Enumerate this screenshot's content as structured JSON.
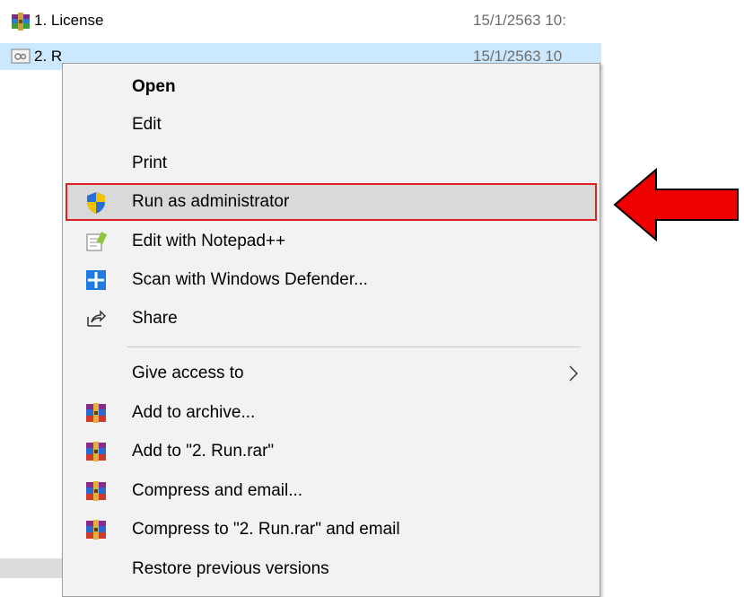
{
  "files": [
    {
      "name": "1. License",
      "date": "15/1/2563 10:",
      "icon": "winrar-archive-icon"
    },
    {
      "name": "2. R",
      "date": "15/1/2563 10",
      "icon": "batch-file-icon"
    }
  ],
  "menu": {
    "items": [
      {
        "label": "Open",
        "bold": true
      },
      {
        "label": "Edit"
      },
      {
        "label": "Print"
      },
      {
        "label": "Run as administrator",
        "icon": "uac-shield-icon",
        "highlighted": true
      },
      {
        "label": "Edit with Notepad++",
        "icon": "notepad-plus-plus-icon"
      },
      {
        "label": "Scan with Windows Defender...",
        "icon": "windows-defender-icon"
      },
      {
        "label": "Share",
        "icon": "share-icon"
      },
      {
        "label": "Give access to",
        "submenu": true
      },
      {
        "label": "Add to archive...",
        "icon": "winrar-icon"
      },
      {
        "label": "Add to \"2. Run.rar\"",
        "icon": "winrar-icon"
      },
      {
        "label": "Compress and email...",
        "icon": "winrar-icon"
      },
      {
        "label": "Compress to \"2. Run.rar\" and email",
        "icon": "winrar-icon"
      },
      {
        "label": "Restore previous versions"
      }
    ]
  },
  "colors": {
    "selection": "#cce8ff",
    "menu_bg": "#f2f2f2",
    "highlight_border": "#e02020",
    "arrow": "#ee0000"
  }
}
